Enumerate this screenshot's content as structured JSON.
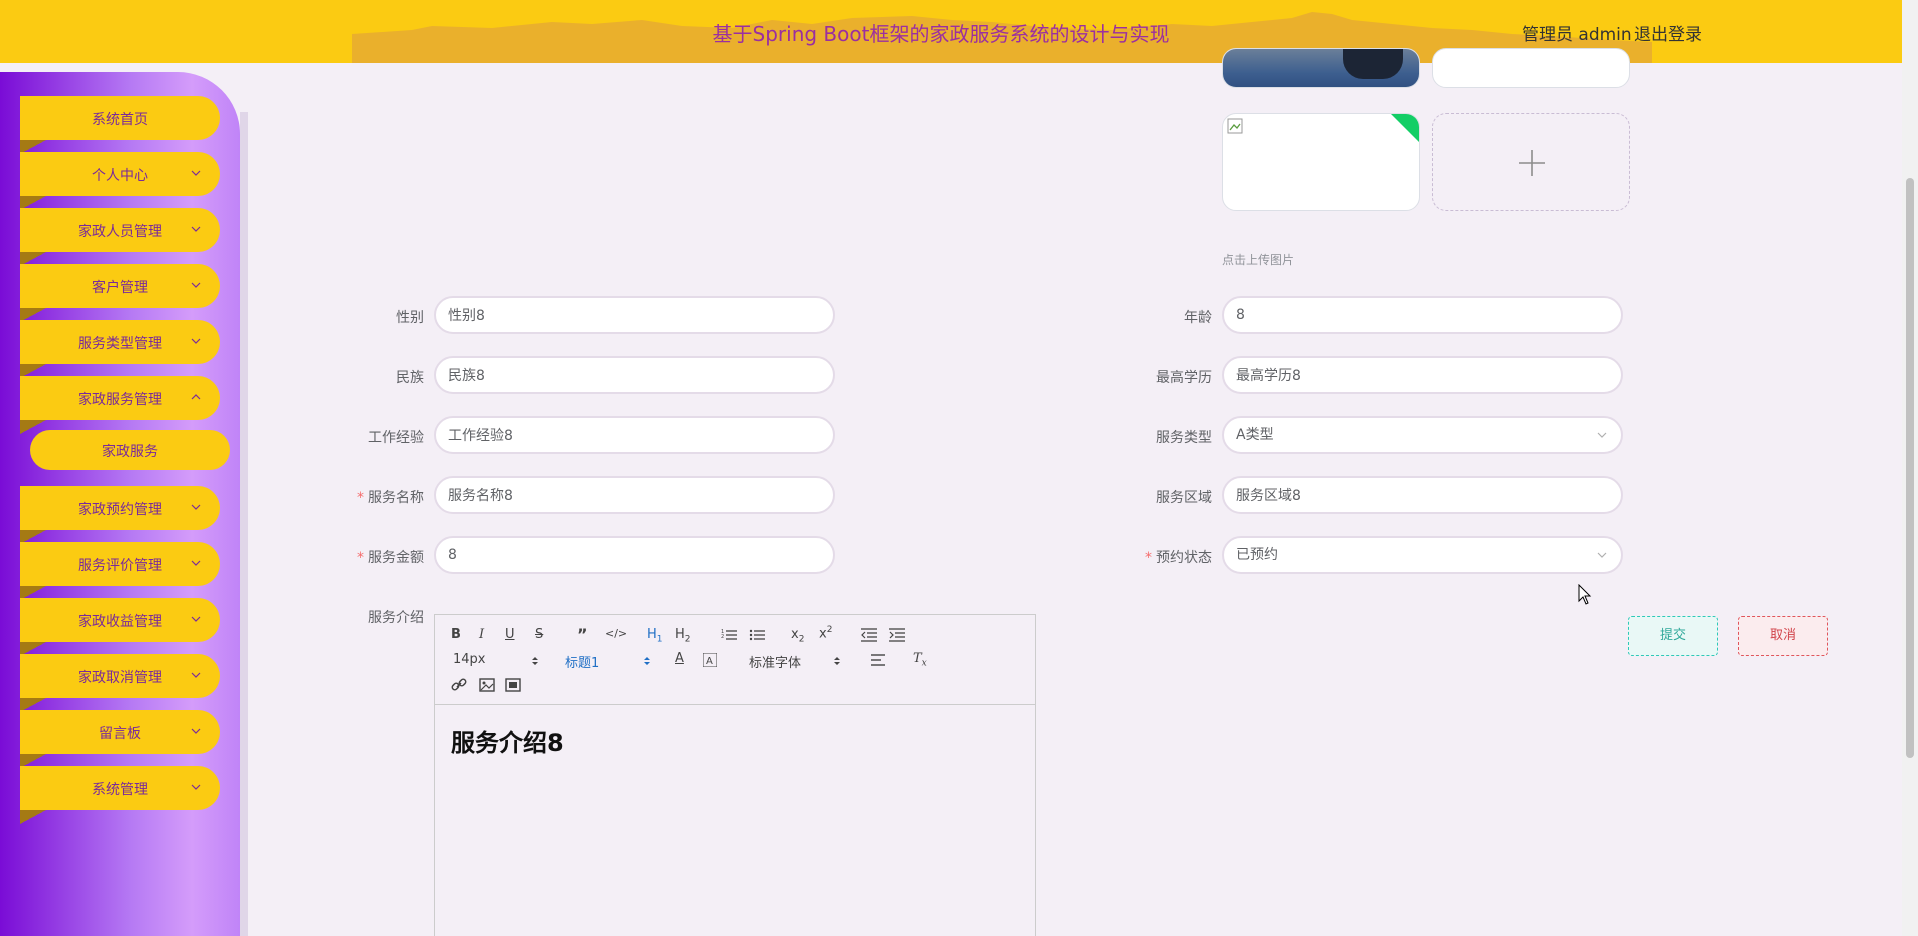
{
  "header": {
    "title": "基于Spring Boot框架的家政服务系统的设计与实现",
    "user": "管理员 admin",
    "logout": "退出登录"
  },
  "sidebar": {
    "items": [
      {
        "label": "系统首页",
        "chevron": false
      },
      {
        "label": "个人中心",
        "chevron": true
      },
      {
        "label": "家政人员管理",
        "chevron": true
      },
      {
        "label": "客户管理",
        "chevron": true
      },
      {
        "label": "服务类型管理",
        "chevron": true
      },
      {
        "label": "家政服务管理",
        "chevron": true,
        "expanded": true
      },
      {
        "label": "家政预约管理",
        "chevron": true
      },
      {
        "label": "服务评价管理",
        "chevron": true
      },
      {
        "label": "家政收益管理",
        "chevron": true
      },
      {
        "label": "家政取消管理",
        "chevron": true
      },
      {
        "label": "留言板",
        "chevron": true
      },
      {
        "label": "系统管理",
        "chevron": true
      }
    ],
    "sub_item": "家政服务"
  },
  "upload": {
    "hint": "点击上传图片"
  },
  "form": {
    "gender": {
      "label": "性别",
      "value": "性别8"
    },
    "age": {
      "label": "年龄",
      "value": "8"
    },
    "ethnicity": {
      "label": "民族",
      "value": "民族8"
    },
    "education": {
      "label": "最高学历",
      "value": "最高学历8"
    },
    "experience": {
      "label": "工作经验",
      "value": "工作经验8"
    },
    "service_type": {
      "label": "服务类型",
      "value": "A类型"
    },
    "service_name": {
      "label": "服务名称",
      "value": "服务名称8",
      "required": true
    },
    "service_area": {
      "label": "服务区域",
      "value": "服务区域8"
    },
    "service_amount": {
      "label": "服务金额",
      "value": "8",
      "required": true
    },
    "booking_status": {
      "label": "预约状态",
      "value": "已预约",
      "required": true
    },
    "intro": {
      "label": "服务介绍"
    }
  },
  "editor": {
    "font_size": "14px",
    "heading": "标题1",
    "font_family": "标准字体",
    "content": "服务介绍8"
  },
  "buttons": {
    "submit": "提交",
    "cancel": "取消"
  },
  "colors": {
    "header": "#fbcb12",
    "title": "#9b2fa0",
    "sidebar_gradient_start": "#7a0cd6",
    "menu_item": "#fbcb12"
  }
}
